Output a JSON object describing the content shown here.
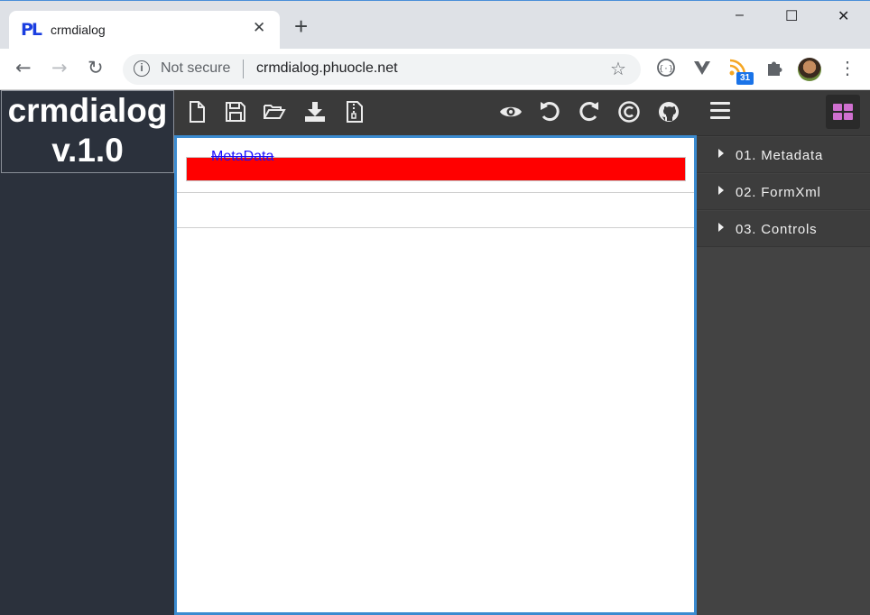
{
  "browser": {
    "tab_favicon": "PL",
    "tab_title": "crmdialog",
    "tab_close": "✕",
    "new_tab": "+",
    "win_min": "–",
    "win_max": "☐",
    "win_close": "✕",
    "back": "←",
    "forward": "→",
    "reload": "↻",
    "security_icon": "i",
    "security_text": "Not secure",
    "url": "crmdialog.phuocle.net",
    "bookmark_star": "☆",
    "ext_calendar_badge": "31",
    "menu": "⋮"
  },
  "app": {
    "logo_line1": "crmdialog",
    "logo_line2": "v.1.0",
    "toolbar_icons": [
      "new-file-icon",
      "save-icon",
      "open-folder-icon",
      "download-icon",
      "zip-file-icon",
      "preview-eye-icon",
      "undo-icon",
      "redo-icon",
      "copyright-icon",
      "github-icon"
    ],
    "editor": {
      "metadata_label": "MetaData"
    },
    "nav": {
      "items": [
        {
          "label": "01. Metadata"
        },
        {
          "label": "02. FormXml"
        },
        {
          "label": "03. Controls"
        }
      ]
    },
    "colors": {
      "accent_border": "#3b8bd0",
      "red_bar": "#ff0000",
      "grid_icon": "#d070d0"
    }
  }
}
